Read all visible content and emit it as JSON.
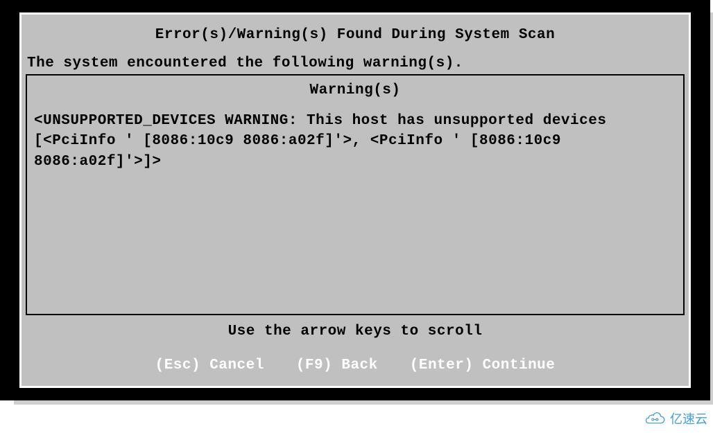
{
  "dialog": {
    "title": "Error(s)/Warning(s) Found During System Scan",
    "subtitle": "The system encountered the following warning(s).",
    "warning_heading": "Warning(s)",
    "warning_body": "<UNSUPPORTED_DEVICES WARNING: This host has unsupported devices [<PciInfo ' [8086:10c9 8086:a02f]'>, <PciInfo ' [8086:10c9 8086:a02f]'>]>",
    "scroll_hint": "Use the arrow keys to scroll"
  },
  "actions": {
    "cancel": "(Esc) Cancel",
    "back": "(F9) Back",
    "continue": "(Enter) Continue"
  },
  "watermark": {
    "text": "亿速云"
  }
}
